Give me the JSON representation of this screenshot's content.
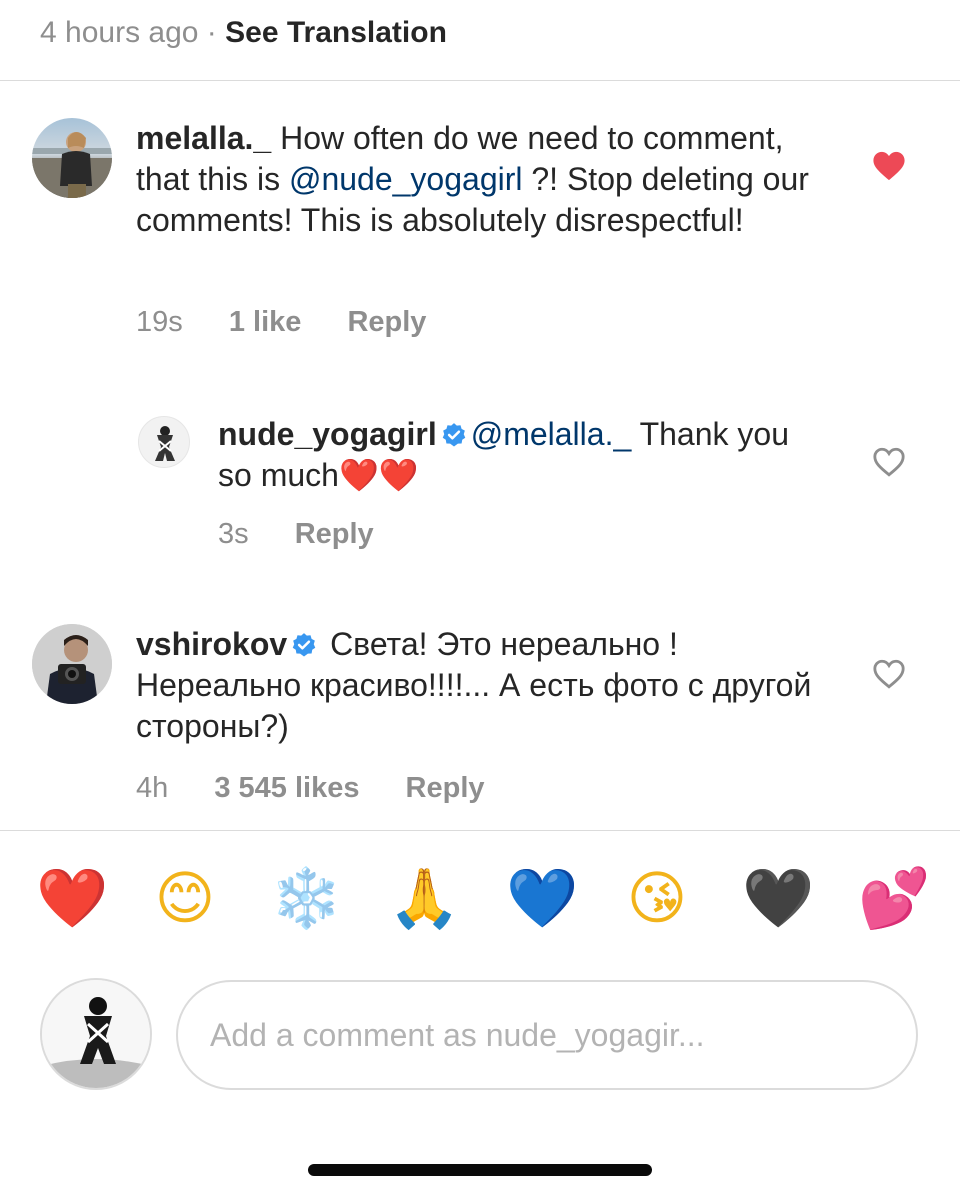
{
  "post_meta": {
    "time": "4 hours ago",
    "separator": "·",
    "see_translation": "See Translation"
  },
  "comments": [
    {
      "username": "melalla._",
      "text_before": " How often do we need to comment, that this is ",
      "mention": "@nude_yogagirl",
      "text_after": " ?! Stop deleting our comments! This is absolutely disrespectful!",
      "time": "19s",
      "likes": "1 like",
      "reply": "Reply",
      "liked": true
    },
    {
      "username": "nude_yogagirl",
      "verified": true,
      "mention": "@melalla._",
      "text_after": " Thank you so much",
      "emojis": "❤️❤️",
      "time": "3s",
      "reply": "Reply",
      "liked": false
    },
    {
      "username": "vshirokov",
      "verified": true,
      "text": " Света! Это нереально ! Нереально красиво!!!!... А есть фото с другой стороны?)",
      "time": "4h",
      "likes": "3 545 likes",
      "reply": "Reply",
      "liked": false
    }
  ],
  "quick_emojis": [
    "❤️",
    "😊",
    "❄️",
    "🙏",
    "💙",
    "😘",
    "🖤",
    "💕"
  ],
  "comment_input": {
    "placeholder": "Add a comment as nude_yogagir..."
  },
  "colors": {
    "like_red": "#ed4956",
    "verified_blue": "#3897f0",
    "mention_blue": "#00376b",
    "muted": "#8e8e8e"
  }
}
